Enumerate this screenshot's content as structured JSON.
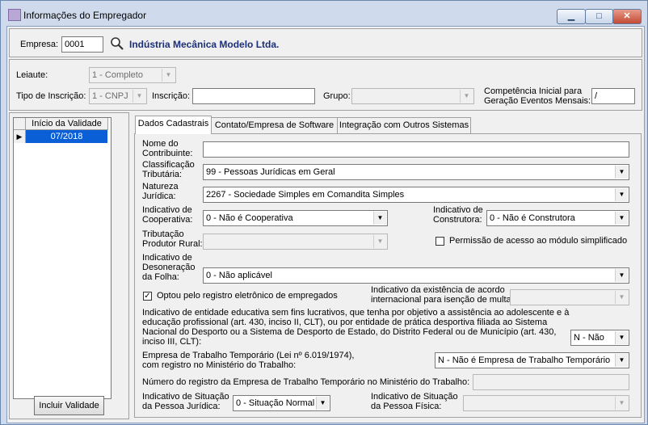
{
  "window": {
    "title": "Informações do Empregador",
    "minimize_glyph": "▁",
    "maximize_glyph": "□",
    "close_glyph": "✕"
  },
  "empresa": {
    "label": "Empresa:",
    "code": "0001",
    "name": "Indústria Mecânica Modelo Ltda."
  },
  "top_form": {
    "leiaute_label": "Leiaute:",
    "leiaute_value": "1 - Completo",
    "tipo_inscricao_label": "Tipo de Inscrição:",
    "tipo_inscricao_value": "1 - CNPJ",
    "inscricao_label": "Inscrição:",
    "inscricao_value": "",
    "grupo_label": "Grupo:",
    "grupo_value": "",
    "competencia_label_1": "Competência Inicial para",
    "competencia_label_2": "Geração Eventos Mensais:",
    "competencia_value": "/"
  },
  "validity_grid": {
    "header": "Início da Validade",
    "rows": [
      {
        "value": "07/2018",
        "selected": true
      }
    ],
    "row_marker": "▶",
    "add_button": "Incluir Validade"
  },
  "tabs": [
    {
      "label": "Dados Cadastrais",
      "active": true
    },
    {
      "label": "Contato/Empresa de Software",
      "active": false
    },
    {
      "label": "Integração com Outros Sistemas",
      "active": false
    }
  ],
  "form": {
    "nome_label_1": "Nome do",
    "nome_label_2": "Contribuinte:",
    "nome_value": "",
    "classificacao_label_1": "Classificação",
    "classificacao_label_2": "Tributária:",
    "classificacao_value": "99 - Pessoas Jurídicas em Geral",
    "natureza_label_1": "Natureza",
    "natureza_label_2": "Jurídica:",
    "natureza_value": "2267 - Sociedade Simples em Comandita Simples",
    "cooperativa_label_1": "Indicativo de",
    "cooperativa_label_2": "Cooperativa:",
    "cooperativa_value": "0 - Não é Cooperativa",
    "construtora_label_1": "Indicativo de",
    "construtora_label_2": "Construtora:",
    "construtora_value": "0 - Não é Construtora",
    "tributacao_label_1": "Tributação",
    "tributacao_label_2": "Produtor Rural:",
    "tributacao_value": "",
    "permissao_label": "Permissão de acesso ao módulo simplificado",
    "permissao_checked": false,
    "desoneracao_label_1": "Indicativo de",
    "desoneracao_label_2": "Desoneração",
    "desoneracao_label_3": "da Folha:",
    "desoneracao_value": "0 - Não aplicável",
    "registro_eletronico_label": "Optou pelo registro eletrônico de empregados",
    "registro_eletronico_checked": true,
    "check_glyph": "✓",
    "isencao_label_1": "Indicativo da existência de acordo",
    "isencao_label_2": "internacional para isenção de multa:",
    "isencao_value": "",
    "educativa_line_1": "Indicativo de entidade educativa sem fins lucrativos, que tenha por objetivo a assistência ao adolescente e à",
    "educativa_line_2": "educação profissional (art. 430, inciso II, CLT), ou por entidade de prática desportiva filiada ao Sistema",
    "educativa_line_3": "Nacional do Desporto ou a Sistema de Desporto de Estado, do Distrito Federal ou de Município (art. 430,",
    "educativa_line_4": "inciso III, CLT):",
    "educativa_value": "N - Não",
    "temporario_label_1": "Empresa de Trabalho Temporário (Lei nº 6.019/1974),",
    "temporario_label_2": "com registro no Ministério do Trabalho:",
    "temporario_value": "N - Não é Empresa de Trabalho Temporário",
    "numero_registro_label": "Número do registro da Empresa de Trabalho Temporário no Ministério do Trabalho:",
    "numero_registro_value": "",
    "situacao_pj_label_1": "Indicativo de Situação",
    "situacao_pj_label_2": "da Pessoa Jurídica:",
    "situacao_pj_value": "0 - Situação Normal",
    "situacao_pf_label_1": "Indicativo de Situação",
    "situacao_pf_label_2": "da Pessoa Física:",
    "situacao_pf_value": "",
    "dropdown_glyph": "▼"
  }
}
